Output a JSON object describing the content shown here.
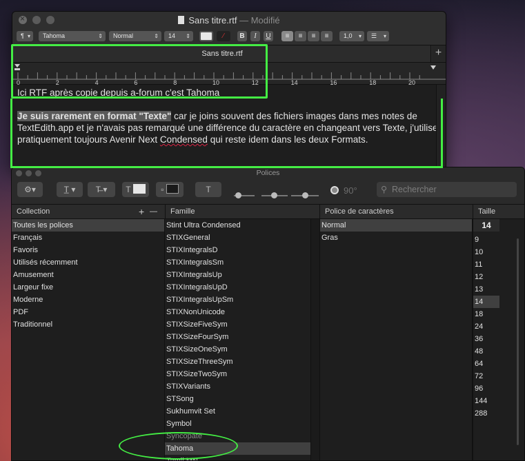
{
  "textedit": {
    "title": "Sans titre.rtf",
    "title_suffix": "— Modifié",
    "toolbar": {
      "paragraph_icon": "¶",
      "font_family": "Tahoma",
      "font_style": "Normal",
      "font_size": "14",
      "bold": "B",
      "italic": "I",
      "underline": "U",
      "line_spacing": "1,0"
    },
    "tab_label": "Sans titre.rtf",
    "tab_add": "+",
    "ruler_numbers": [
      "0",
      "2",
      "4",
      "6",
      "8",
      "10",
      "12",
      "14",
      "16",
      "18",
      "20"
    ],
    "content": {
      "line1": "Ici RTF après copie depuis a-forum c'est Tahoma",
      "p2_highlight": "Je suis rarement en format \"Texte\"",
      "p2_rest1": " car je joins souvent des fichiers images dans mes notes de TextEdith.app et je n'avais pas remarqué une différence du caractère en changeant vers Texte, j'utilise pratiquement toujours Avenir Next ",
      "p2_squiggle": "Condensed",
      "p2_rest2": " qui reste idem dans les deux Formats."
    }
  },
  "fonts_panel": {
    "title": "Polices",
    "search_placeholder": "Rechercher",
    "rotation": "90°",
    "headers": {
      "collection": "Collection",
      "collection_add": "+",
      "collection_remove": "—",
      "family": "Famille",
      "typeface": "Police de caractères",
      "size": "Taille"
    },
    "collections": [
      "Toutes les polices",
      "Français",
      "Favoris",
      "Utilisés récemment",
      "Amusement",
      "Largeur fixe",
      "Moderne",
      "PDF",
      "Traditionnel"
    ],
    "selected_collection": "Toutes les polices",
    "families": [
      "Stint Ultra Condensed",
      "STIXGeneral",
      "STIXIntegralsD",
      "STIXIntegralsSm",
      "STIXIntegralsUp",
      "STIXIntegralsUpD",
      "STIXIntegralsUpSm",
      "STIXNonUnicode",
      "STIXSizeFiveSym",
      "STIXSizeFourSym",
      "STIXSizeOneSym",
      "STIXSizeThreeSym",
      "STIXSizeTwoSym",
      "STIXVariants",
      "STSong",
      "Sukhumvit Set",
      "Symbol",
      "Syncopate",
      "Tahoma",
      "Tamil MN"
    ],
    "selected_family": "Tahoma",
    "typefaces": [
      "Normal",
      "Gras"
    ],
    "selected_typeface": "Normal",
    "size_value": "14",
    "sizes": [
      "9",
      "10",
      "11",
      "12",
      "13",
      "14",
      "18",
      "24",
      "36",
      "48",
      "64",
      "72",
      "96",
      "144",
      "288"
    ],
    "selected_size": "14"
  }
}
